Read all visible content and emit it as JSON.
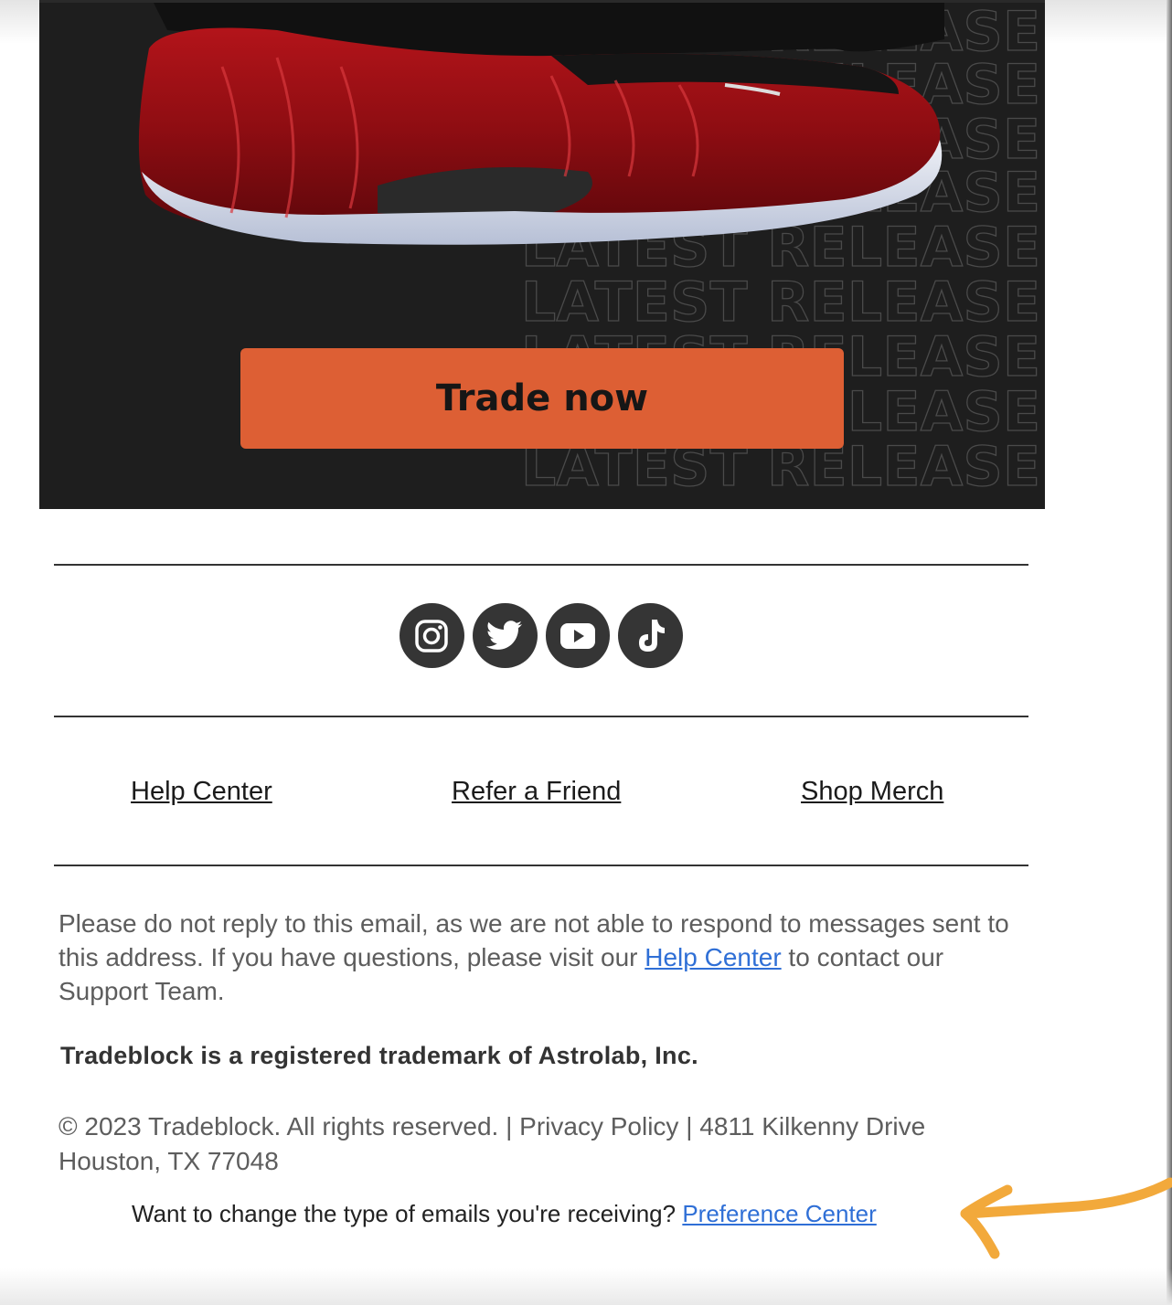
{
  "hero": {
    "watermark_text": "LATEST RELEASE",
    "cta_label": "Trade now",
    "cta_color": "#dd5f34",
    "background_color": "#1e1e1e"
  },
  "social": {
    "icons": [
      "instagram-icon",
      "twitter-icon",
      "youtube-icon",
      "tiktok-icon"
    ]
  },
  "footer_links": {
    "help_center": "Help Center",
    "refer_friend": "Refer a Friend",
    "shop_merch": "Shop Merch"
  },
  "notice": {
    "text_before_link": "Please do not reply to this email, as we are not able to respond to messages sent to this address. If you have questions, please visit our ",
    "link_text": "Help Center",
    "text_after_link": " to contact our Support Team."
  },
  "trademark": "Tradeblock is a registered trademark of Astrolab, Inc.",
  "copyright": "© 2023 Tradeblock. All rights reserved. | Privacy Policy | 4811 Kilkenny Drive Houston, TX 77048",
  "preference": {
    "question": "Want to change the type of emails you're receiving? ",
    "link_text": "Preference Center"
  },
  "annotation": {
    "arrow_color": "#f2a93b"
  }
}
